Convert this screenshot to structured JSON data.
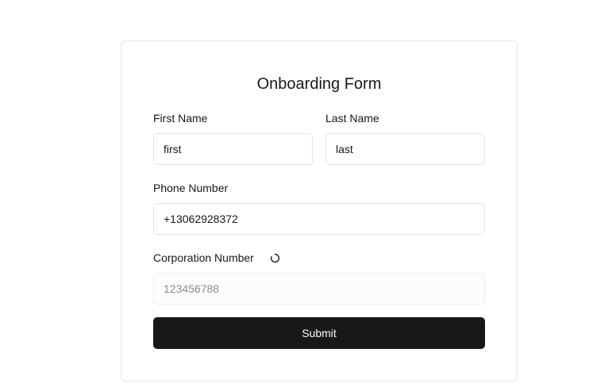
{
  "form": {
    "title": "Onboarding Form",
    "first_name": {
      "label": "First Name",
      "value": "first",
      "placeholder": ""
    },
    "last_name": {
      "label": "Last Name",
      "value": "last",
      "placeholder": ""
    },
    "phone": {
      "label": "Phone Number",
      "value": "+13062928372",
      "placeholder": ""
    },
    "corporation": {
      "label": "Corporation Number",
      "value": "",
      "placeholder": "123456788",
      "status_icon": "loading-spinner-icon"
    },
    "submit_label": "Submit"
  },
  "colors": {
    "primary": "#18181b",
    "border": "#e4e4e7",
    "placeholder": "#8a8a93"
  }
}
